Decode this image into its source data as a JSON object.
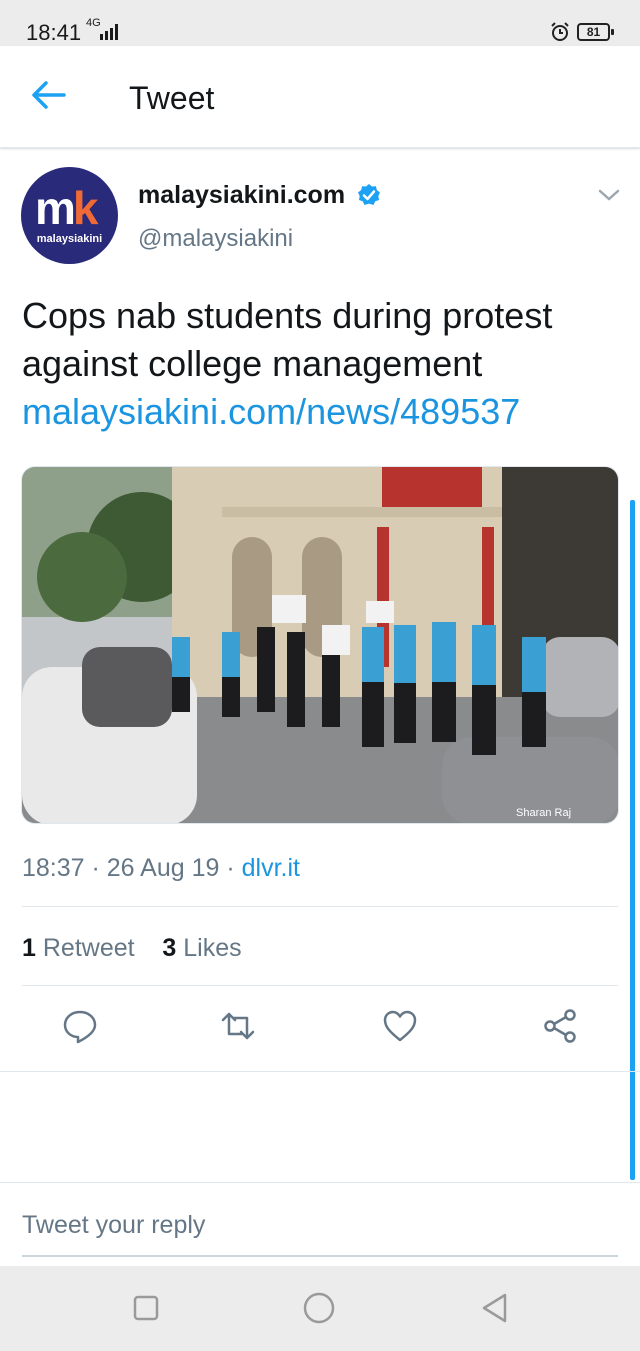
{
  "status": {
    "time": "18:41",
    "network": "4G",
    "battery": "81",
    "icons": [
      "signal-icon",
      "alarm-icon",
      "battery-icon"
    ]
  },
  "header": {
    "title": "Tweet",
    "back_icon": "back-arrow-icon"
  },
  "tweet": {
    "avatar_mark": "m",
    "avatar_mark_accent": "k",
    "avatar_sub": "malaysiakini",
    "name": "malaysiakini.com",
    "handle": "@malaysiakini",
    "text": "Cops nab students during protest against college management",
    "link": "malaysiakini.com/news/489537",
    "media_credit": "Sharan Raj",
    "time": "18:37",
    "date": "26 Aug 19",
    "source": "dlvr.it",
    "retweet_count": "1",
    "retweet_label": "Retweet",
    "like_count": "3",
    "like_label": "Likes"
  },
  "actions": [
    "reply-icon",
    "retweet-icon",
    "like-icon",
    "share-icon"
  ],
  "reply": {
    "placeholder": "Tweet your reply"
  },
  "navbar": [
    "recent-apps-icon",
    "home-icon",
    "back-icon"
  ],
  "colors": {
    "accent": "#1b95e0",
    "text": "#14171a",
    "muted": "#657786",
    "avatar_bg": "#2a2a7a",
    "avatar_accent": "#f06a35"
  }
}
